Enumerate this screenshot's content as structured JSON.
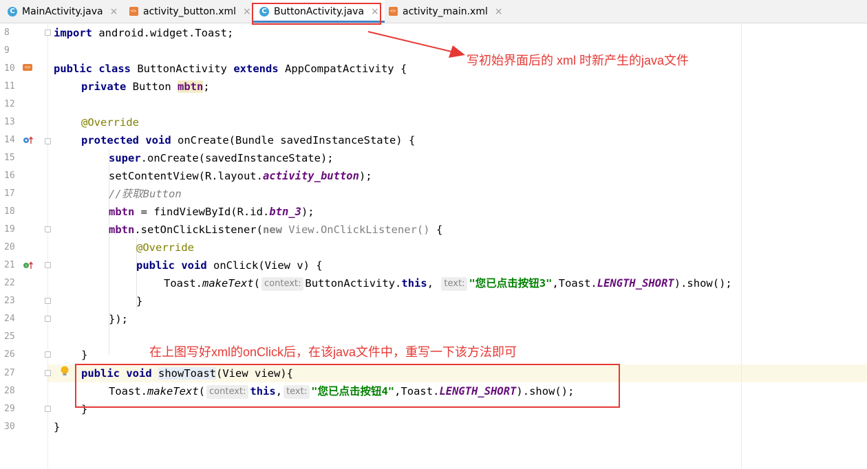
{
  "tabs": [
    {
      "label": "MainActivity.java",
      "icon": "java-class-icon",
      "active": false
    },
    {
      "label": "activity_button.xml",
      "icon": "xml-layout-icon",
      "active": false
    },
    {
      "label": "ButtonActivity.java",
      "icon": "java-class-icon",
      "active": true
    },
    {
      "label": "activity_main.xml",
      "icon": "xml-layout-icon",
      "active": false
    }
  ],
  "tab_close_glyph": "×",
  "line_numbers": [
    "8",
    "9",
    "10",
    "11",
    "12",
    "13",
    "14",
    "15",
    "16",
    "17",
    "18",
    "19",
    "20",
    "21",
    "22",
    "23",
    "24",
    "25",
    "26",
    "27",
    "28",
    "29",
    "30"
  ],
  "code": {
    "l8": {
      "import_kw": "import",
      "rest": " android.widget.Toast;"
    },
    "l10": {
      "kw1": "public",
      "kw2": "class",
      "name": " ButtonActivity ",
      "kw3": "extends",
      "rest": " AppCompatActivity {"
    },
    "l11": {
      "kw": "private",
      "type": " Button ",
      "field": "mbtn",
      "end": ";"
    },
    "l13": {
      "ann": "@Override"
    },
    "l14": {
      "kw1": "protected",
      "kw2": "void",
      "rest": " onCreate(Bundle savedInstanceState) {"
    },
    "l15": {
      "kw": "super",
      "rest": ".onCreate(savedInstanceState);"
    },
    "l16": {
      "pre": "setContentView(R.layout.",
      "field": "activity_button",
      "post": ");"
    },
    "l17": {
      "comment": "//获取Button"
    },
    "l18": {
      "field": "mbtn",
      "pre": " = findViewById(R.id.",
      "id": "btn_3",
      "post": ");"
    },
    "l19": {
      "field": "mbtn",
      "pre": ".setOnClickListener(",
      "kw": "new",
      "gray": " View.OnClickListener()",
      "post": " {"
    },
    "l20": {
      "ann": "@Override"
    },
    "l21": {
      "kw1": "public",
      "kw2": "void",
      "rest": " onClick(View v) {"
    },
    "l22": {
      "pre": "Toast.",
      "method": "makeText",
      "open": "(",
      "hint1": "context:",
      "arg1": "ButtonActivity.",
      "kw": "this",
      "comma": ",",
      "hint2": "text:",
      "str": "\"您已点击按钮3\"",
      "mid": ",Toast.",
      "const": "LENGTH_SHORT",
      "post": ").show();"
    },
    "l23": {
      "text": "}"
    },
    "l24": {
      "text": "});"
    },
    "l26": {
      "text": "}"
    },
    "l27": {
      "kw1": "public",
      "kw2": "void",
      "method": "showToast",
      "rest": "(View view){"
    },
    "l28": {
      "pre": "Toast.",
      "method": "makeText",
      "open": "(",
      "hint1": "context:",
      "kw": "this",
      "comma": ",",
      "hint2": "text:",
      "str": "\"您已点击按钮4\"",
      "mid": ",Toast.",
      "const": "LENGTH_SHORT",
      "post": ").show();"
    },
    "l29": {
      "text": "}"
    },
    "l30": {
      "text": "}"
    }
  },
  "annotations": {
    "top_note": "写初始界面后的 xml 时新产生的java文件",
    "bottom_note": "在上图写好xml的onClick后，在该java文件中，重写一下该方法即可"
  },
  "colors": {
    "annotation_red": "#e53935",
    "keyword": "#000080",
    "string": "#008000",
    "field": "#660e7a",
    "active_tab_underline": "#4083c9"
  }
}
